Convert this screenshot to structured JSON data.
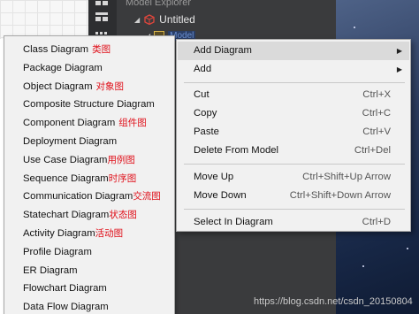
{
  "explorer": {
    "title": "Model Explorer",
    "project_label": "Untitled",
    "model_label": "Model"
  },
  "submenu": {
    "items": [
      {
        "label": "Class Diagram",
        "cn": "类图"
      },
      {
        "label": "Package Diagram",
        "cn": ""
      },
      {
        "label": "Object Diagram",
        "cn": "对象图"
      },
      {
        "label": "Composite Structure Diagram",
        "cn": ""
      },
      {
        "label": "Component Diagram",
        "cn": "组件图"
      },
      {
        "label": "Deployment Diagram",
        "cn": ""
      },
      {
        "label": "Use Case Diagram",
        "cn": "用例图"
      },
      {
        "label": "Sequence Diagram",
        "cn": "时序图"
      },
      {
        "label": "Communication Diagram",
        "cn": "交流图"
      },
      {
        "label": "Statechart Diagram",
        "cn": "状态图"
      },
      {
        "label": "Activity Diagram",
        "cn": "活动图"
      },
      {
        "label": "Profile Diagram",
        "cn": ""
      },
      {
        "label": "ER Diagram",
        "cn": ""
      },
      {
        "label": "Flowchart Diagram",
        "cn": ""
      },
      {
        "label": "Data Flow Diagram",
        "cn": ""
      }
    ]
  },
  "context_menu": {
    "add_diagram": "Add Diagram",
    "add": "Add",
    "cut": "Cut",
    "cut_shortcut": "Ctrl+X",
    "copy": "Copy",
    "copy_shortcut": "Ctrl+C",
    "paste": "Paste",
    "paste_shortcut": "Ctrl+V",
    "delete_from_model": "Delete From Model",
    "delete_shortcut": "Ctrl+Del",
    "move_up": "Move Up",
    "move_up_shortcut": "Ctrl+Shift+Up Arrow",
    "move_down": "Move Down",
    "move_down_shortcut": "Ctrl+Shift+Down Arrow",
    "select_in_diagram": "Select In Diagram",
    "select_shortcut": "Ctrl+D"
  },
  "watermark": "https://blog.csdn.net/csdn_20150804",
  "colors": {
    "menu_bg": "#f1f1f1",
    "highlight": "#dadada",
    "annotation_red": "#e0101a",
    "explorer_bg": "#3a3b3d"
  },
  "icons": [
    "grid-view-icon",
    "list-view-icon",
    "project-cube-icon",
    "model-package-icon",
    "submenu-arrow-icon"
  ]
}
